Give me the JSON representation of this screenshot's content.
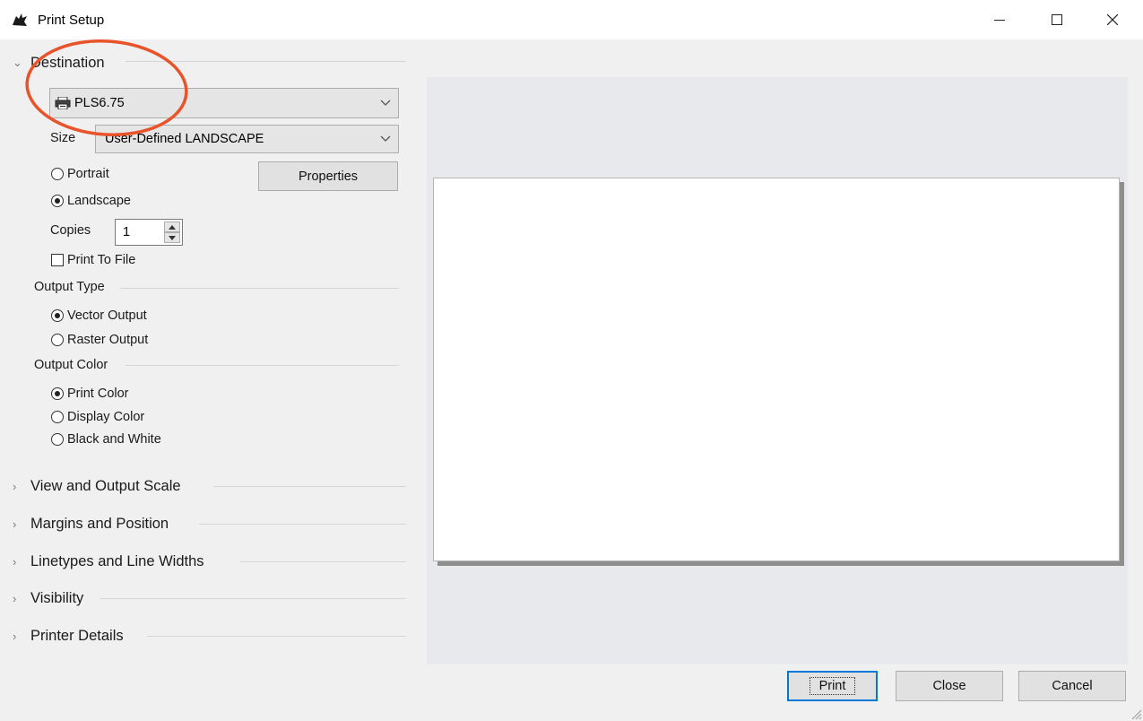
{
  "window": {
    "title": "Print Setup"
  },
  "destination": {
    "header": "Destination",
    "printer": "PLS6.75",
    "size_label": "Size",
    "size_value": "User-Defined LANDSCAPE",
    "orientation_portrait": "Portrait",
    "orientation_landscape": "Landscape",
    "orientation_selected": "Landscape",
    "properties_button": "Properties",
    "copies_label": "Copies",
    "copies_value": "1",
    "print_to_file": "Print To File",
    "print_to_file_checked": false
  },
  "output_type": {
    "label": "Output Type",
    "vector": "Vector Output",
    "raster": "Raster Output",
    "selected": "Vector Output"
  },
  "output_color": {
    "label": "Output Color",
    "print_color": "Print Color",
    "display_color": "Display Color",
    "black_white": "Black and White",
    "selected": "Print Color"
  },
  "sections": {
    "view_output_scale": "View and Output Scale",
    "margins_position": "Margins and Position",
    "linetypes": "Linetypes and Line Widths",
    "visibility": "Visibility",
    "printer_details": "Printer Details"
  },
  "footer": {
    "print": "Print",
    "close": "Close",
    "cancel": "Cancel"
  },
  "colors": {
    "annotation": "#e8532a",
    "default_button_border": "#0078d7"
  }
}
